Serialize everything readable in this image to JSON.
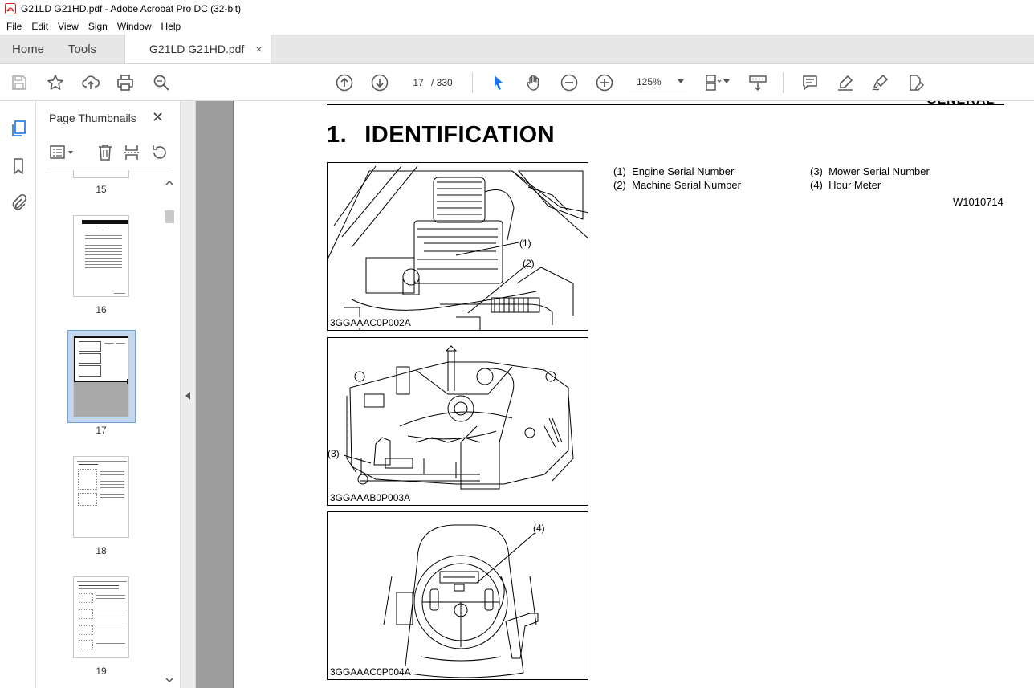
{
  "window": {
    "title": "G21LD G21HD.pdf - Adobe Acrobat Pro DC (32-bit)"
  },
  "menu": [
    "File",
    "Edit",
    "View",
    "Sign",
    "Window",
    "Help"
  ],
  "tabs": {
    "home": "Home",
    "tools": "Tools",
    "document": "G21LD G21HD.pdf",
    "close_glyph": "×"
  },
  "toolbar": {
    "current_page": "17",
    "total_pages": "/ 330",
    "zoom": "125%"
  },
  "thumbnail_panel": {
    "title": "Page Thumbnails",
    "close_glyph": "✕",
    "pages": [
      {
        "label": "15",
        "selected": false
      },
      {
        "label": "16",
        "selected": false
      },
      {
        "label": "17",
        "selected": true
      },
      {
        "label": "18",
        "selected": false
      },
      {
        "label": "19",
        "selected": false
      }
    ]
  },
  "document": {
    "header_fragment": "GENERAL",
    "heading_number": "1.",
    "heading_text": "IDENTIFICATION",
    "figures": [
      {
        "code": "3GGAAAC0P002A",
        "callouts": [
          "(1)",
          "(2)"
        ]
      },
      {
        "code": "3GGAAAB0P003A",
        "callouts": [
          "(3)"
        ]
      },
      {
        "code": "3GGAAAC0P004A",
        "callouts": [
          "(4)"
        ]
      }
    ],
    "legend": [
      {
        "num": "(1)",
        "text": "Engine Serial Number"
      },
      {
        "num": "(2)",
        "text": "Machine Serial Number"
      },
      {
        "num": "(3)",
        "text": "Mower Serial Number"
      },
      {
        "num": "(4)",
        "text": "Hour Meter"
      }
    ],
    "legend_code": "W1010714"
  },
  "colors": {
    "accent": "#1473e6",
    "tabbar_bg": "#e7e7e7",
    "doc_bg": "#9d9d9d",
    "icon": "#5a5a5a"
  }
}
